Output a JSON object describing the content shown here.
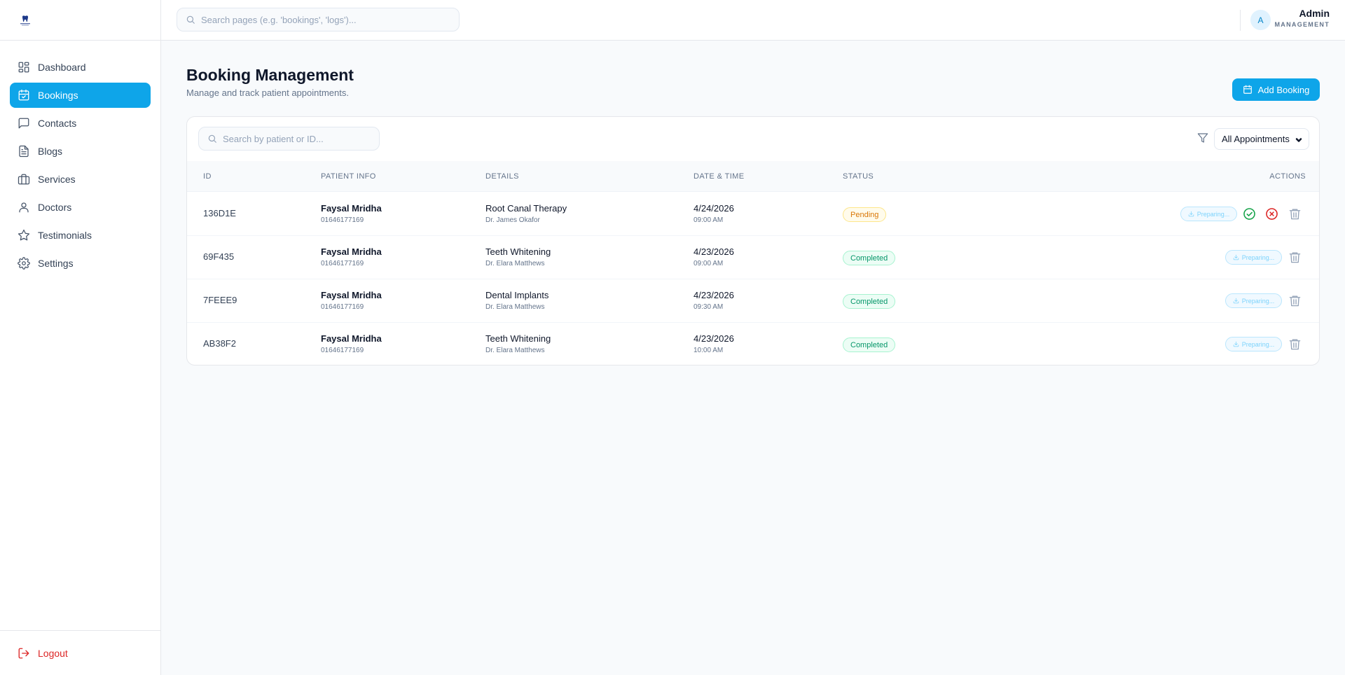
{
  "sidebar": {
    "items": [
      {
        "label": "Dashboard",
        "icon": "dashboard-icon"
      },
      {
        "label": "Bookings",
        "icon": "calendar-check-icon",
        "active": true
      },
      {
        "label": "Contacts",
        "icon": "message-icon"
      },
      {
        "label": "Blogs",
        "icon": "document-icon"
      },
      {
        "label": "Services",
        "icon": "briefcase-icon"
      },
      {
        "label": "Doctors",
        "icon": "user-icon"
      },
      {
        "label": "Testimonials",
        "icon": "star-icon"
      },
      {
        "label": "Settings",
        "icon": "gear-icon"
      }
    ],
    "logout_label": "Logout"
  },
  "topbar": {
    "search_placeholder": "Search pages (e.g. 'bookings', 'logs')...",
    "avatar_initial": "A",
    "user_name": "Admin",
    "user_role": "MANAGEMENT"
  },
  "main": {
    "title": "Booking Management",
    "subtitle": "Manage and track patient appointments.",
    "add_button_label": "Add Booking",
    "table_search_placeholder": "Search by patient or ID...",
    "filter_value": "All Appointments"
  },
  "table": {
    "headers": {
      "id": "ID",
      "patient": "PATIENT INFO",
      "details": "DETAILS",
      "datetime": "DATE & TIME",
      "status": "STATUS",
      "actions": "ACTIONS"
    },
    "rows": [
      {
        "id": "136D1E",
        "patient_name": "Faysal Mridha",
        "patient_phone": "01646177169",
        "service": "Root Canal Therapy",
        "doctor": "Dr. James Okafor",
        "date": "4/24/2026",
        "time": "09:00 AM",
        "status": "Pending",
        "download_label": "Preparing..."
      },
      {
        "id": "69F435",
        "patient_name": "Faysal Mridha",
        "patient_phone": "01646177169",
        "service": "Teeth Whitening",
        "doctor": "Dr. Elara Matthews",
        "date": "4/23/2026",
        "time": "09:00 AM",
        "status": "Completed",
        "download_label": "Preparing..."
      },
      {
        "id": "7FEEE9",
        "patient_name": "Faysal Mridha",
        "patient_phone": "01646177169",
        "service": "Dental Implants",
        "doctor": "Dr. Elara Matthews",
        "date": "4/23/2026",
        "time": "09:30 AM",
        "status": "Completed",
        "download_label": "Preparing..."
      },
      {
        "id": "AB38F2",
        "patient_name": "Faysal Mridha",
        "patient_phone": "01646177169",
        "service": "Teeth Whitening",
        "doctor": "Dr. Elara Matthews",
        "date": "4/23/2026",
        "time": "10:00 AM",
        "status": "Completed",
        "download_label": "Preparing..."
      }
    ]
  },
  "colors": {
    "accent": "#0ea5e9",
    "pending": "#d97706",
    "completed": "#059669",
    "danger": "#dc2626"
  }
}
